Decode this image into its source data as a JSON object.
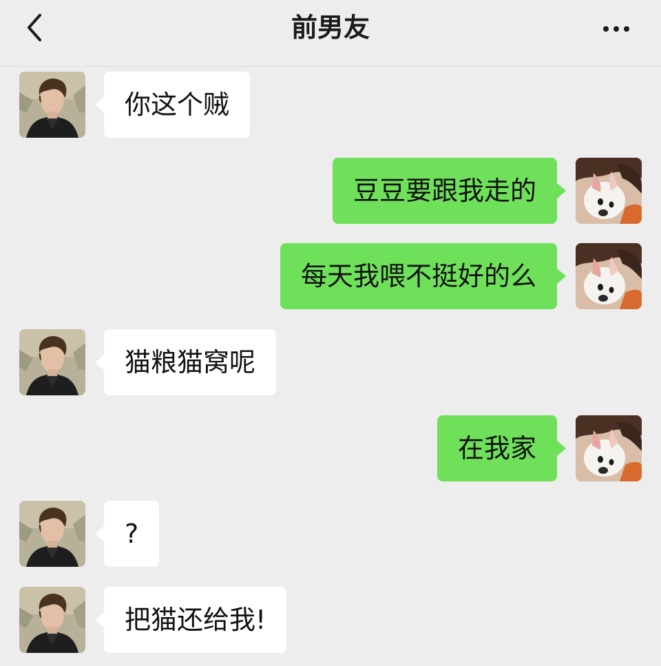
{
  "header": {
    "title": "前男友",
    "back_icon": "chevron-left-icon",
    "more_icon": "more-horizontal-icon"
  },
  "colors": {
    "background": "#ededed",
    "bubble_received": "#ffffff",
    "bubble_sent": "#6fe05a",
    "text": "#121212"
  },
  "messages": [
    {
      "sender": "contact",
      "text": "你这个贼"
    },
    {
      "sender": "me",
      "text": "豆豆要跟我走的"
    },
    {
      "sender": "me",
      "text": "每天我喂不挺好的么"
    },
    {
      "sender": "contact",
      "text": "猫粮猫窝呢"
    },
    {
      "sender": "me",
      "text": "在我家"
    },
    {
      "sender": "contact",
      "text": "?"
    },
    {
      "sender": "contact",
      "text": "把猫还给我!"
    }
  ]
}
